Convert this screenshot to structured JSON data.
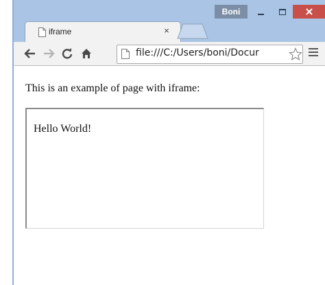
{
  "window": {
    "user_name": "Boni",
    "colors": {
      "frame": "#a9c4e4",
      "close_button": "#c9504a",
      "user_badge": "#7c8ea6"
    }
  },
  "tabs": [
    {
      "title": "iframe",
      "icon": "document-icon",
      "close_glyph": "×"
    }
  ],
  "toolbar": {
    "back_icon": "back-arrow-icon",
    "forward_icon": "forward-arrow-icon",
    "reload_icon": "reload-icon",
    "home_icon": "home-icon",
    "url": "file:///C:/Users/boni/Documents/iframe.html",
    "url_visible": "file:///C:/Users/boni/Docur",
    "bookmark_icon": "star-icon",
    "menu_icon": "hamburger-menu-icon"
  },
  "page": {
    "intro_text": "This is an example of page with iframe:",
    "iframe": {
      "content_text": "Hello World!"
    }
  }
}
